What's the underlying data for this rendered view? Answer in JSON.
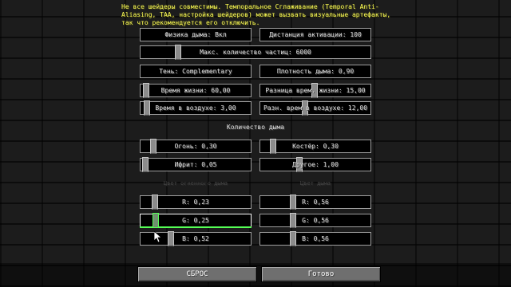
{
  "warning_text": "Не все шейдеры совместимы. Темпоральное Сглаживание (Temporal Anti-Aliasing, TAA, настройка шейдеров) может вызвать визуальные артефакты, так что рекомендуется его отключить.",
  "settings": {
    "smoke_physics": "Физика дыма: Вкл",
    "activation_distance": "Дистанция активации: 100",
    "max_particles": "Макс. количество частиц: 6000",
    "max_particles_level": 0.07,
    "shadow": "Тень: Complementary",
    "smoke_density": "Плотность дыма: 0,90",
    "lifetime": "Время жизни: 60,00",
    "lifetime_level": 0.02,
    "lifetime_diff": "Разница врем. жизни: 15,00",
    "lifetime_diff_level": 0.5,
    "air_time": "Время в воздухе: 3,00",
    "air_time_level": 0.03,
    "air_time_diff": "Разн. врем в воздухе: 12,00",
    "air_time_diff_level": 0.4
  },
  "smoke_amount": {
    "title": "Количество дыма",
    "fire": "Огонь: 0,30",
    "fire_level": 0.06,
    "campfire": "Костёр: 0,30",
    "campfire_level": 0.12,
    "ifrit": "Ифрит: 0,05",
    "ifrit_level": 0.01,
    "other": "Другое: 1,00",
    "other_level": 0.35
  },
  "colors": {
    "left_title": "Цвет огненного дыма",
    "right_title": "Цвет дыма",
    "left": {
      "r": "R: 0,23",
      "g": "G: 0,25",
      "b": "B: 0,52",
      "r_level": 0.23,
      "g_level": 0.25,
      "b_level": 0.52
    },
    "right": {
      "r": "R: 0,56",
      "g": "G: 0,56",
      "b": "B: 0,56",
      "r_level": 0.56,
      "g_level": 0.56,
      "b_level": 0.56
    },
    "accent": "#55ff55"
  },
  "buttons": {
    "reset": "СБРОС",
    "done": "Готово"
  }
}
